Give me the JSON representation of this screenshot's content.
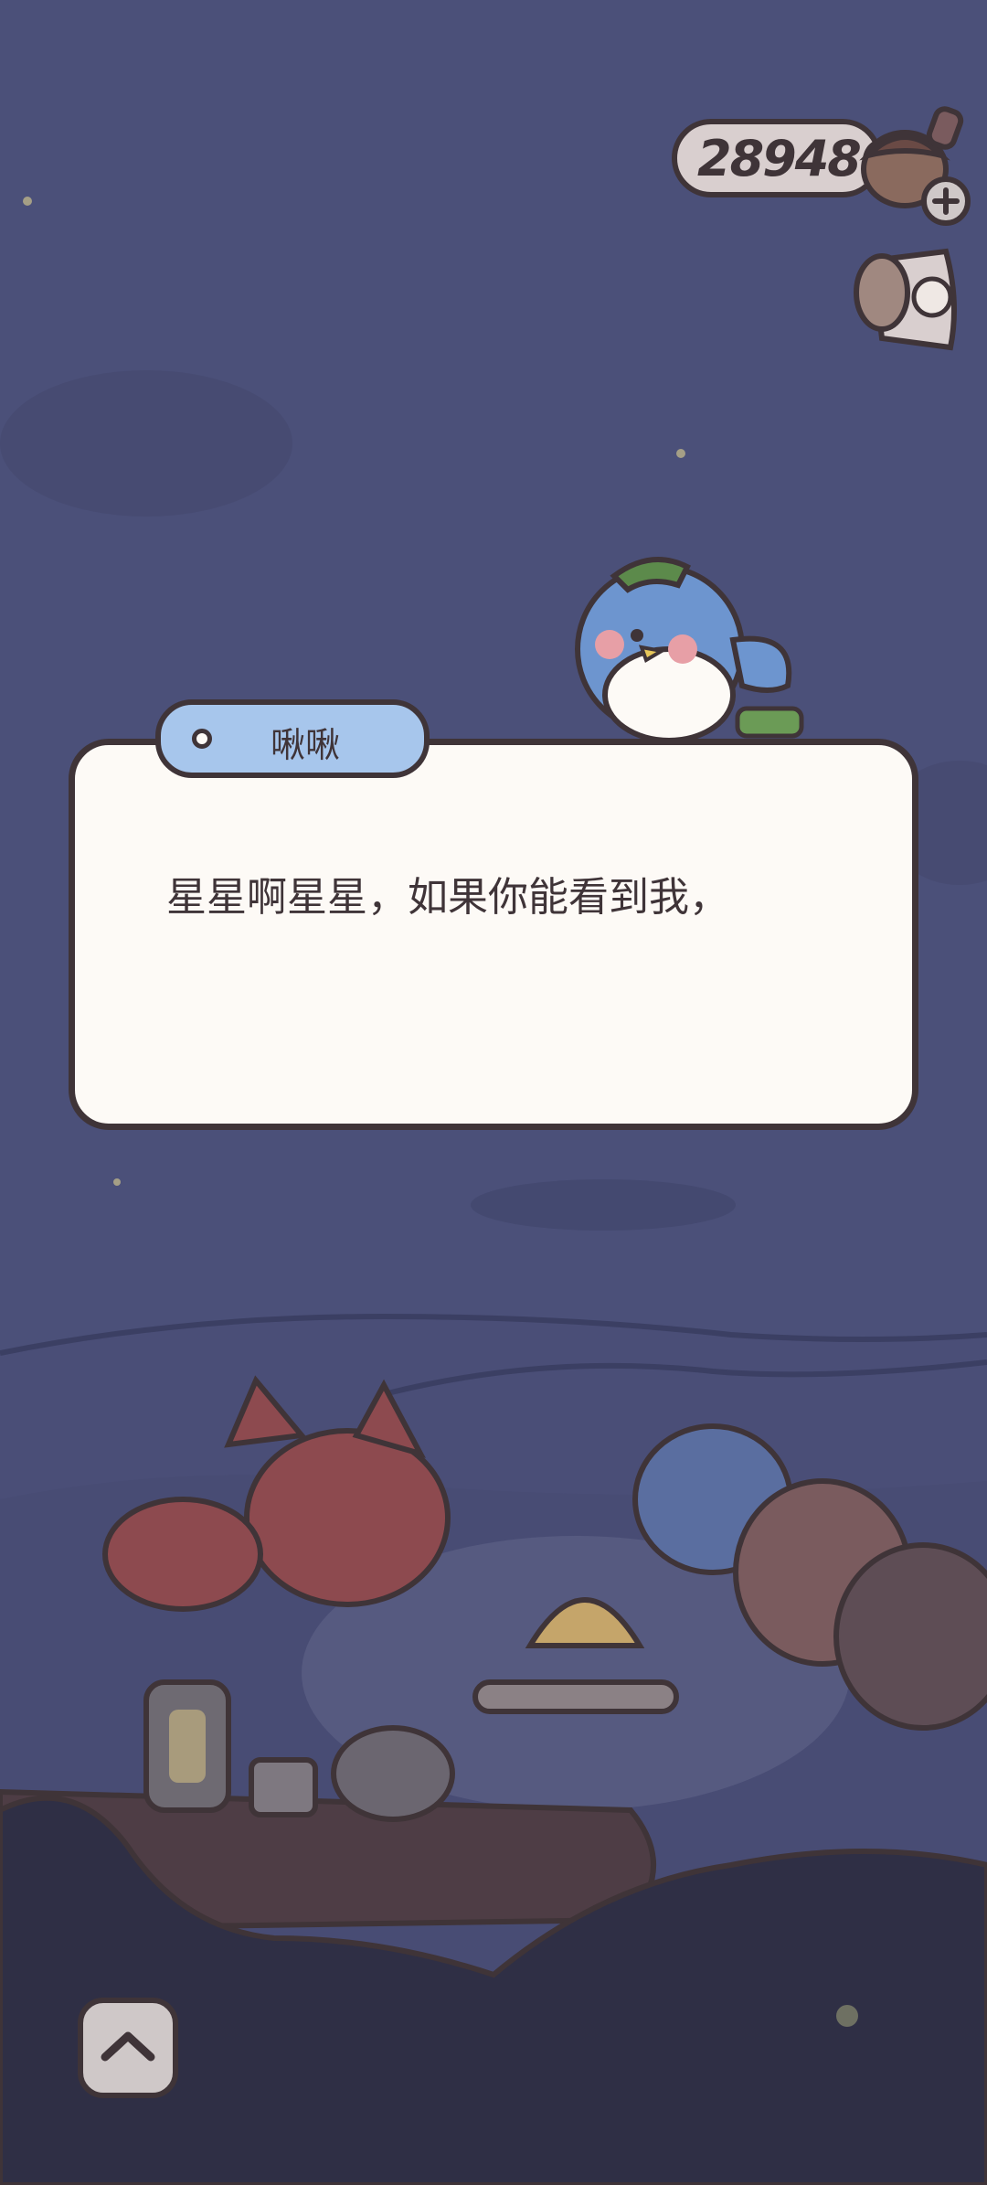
{
  "hud": {
    "acorn_count": "289486",
    "add_currency_icon": "plus-icon",
    "quest_icon": "scroll-icon"
  },
  "dialog": {
    "speaker": "啾啾",
    "text": "星星啊星星，如果你能看到我，"
  },
  "controls": {
    "expand_icon": "chevron-up-icon"
  },
  "colors": {
    "sky": "#4b5079",
    "dialog_bg": "#fdfaf6",
    "name_tag_bg": "#a7c6ec",
    "outline": "#3f3438"
  }
}
